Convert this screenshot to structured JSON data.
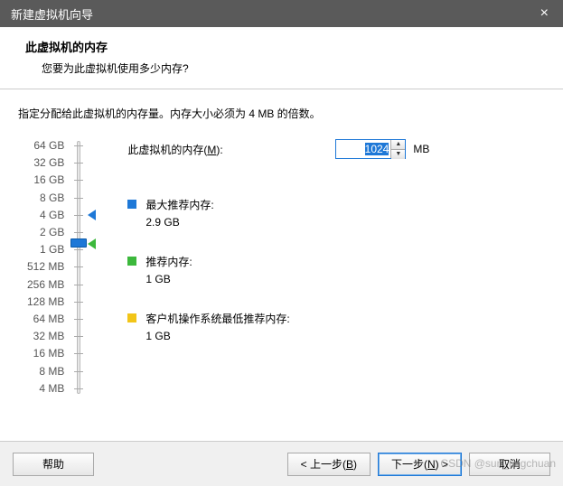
{
  "window": {
    "title": "新建虚拟机向导",
    "close_glyph": "×"
  },
  "header": {
    "title": "此虚拟机的内存",
    "subtitle": "您要为此虚拟机使用多少内存?"
  },
  "instruction": "指定分配给此虚拟机的内存量。内存大小必须为 4 MB 的倍数。",
  "memory": {
    "label_pre": "此虚拟机的内存(",
    "label_key": "M",
    "label_post": "):",
    "value": "1024",
    "unit": "MB"
  },
  "scale_labels": [
    "64 GB",
    "32 GB",
    "16 GB",
    "8 GB",
    "4 GB",
    "2 GB",
    "1 GB",
    "512 MB",
    "256 MB",
    "128 MB",
    "64 MB",
    "32 MB",
    "16 MB",
    "8 MB",
    "4 MB"
  ],
  "recommendations": {
    "max": {
      "title": "最大推荐内存:",
      "value": "2.9 GB"
    },
    "rec": {
      "title": "推荐内存:",
      "value": "1 GB"
    },
    "min": {
      "title": "客户机操作系统最低推荐内存:",
      "value": "1 GB"
    }
  },
  "buttons": {
    "help": "帮助",
    "back_pre": "< 上一步(",
    "back_key": "B",
    "back_post": ")",
    "next_pre": "下一步(",
    "next_key": "N",
    "next_post": ") >",
    "cancel": "取消"
  },
  "watermark": "CSDN @sun_tingchuan"
}
